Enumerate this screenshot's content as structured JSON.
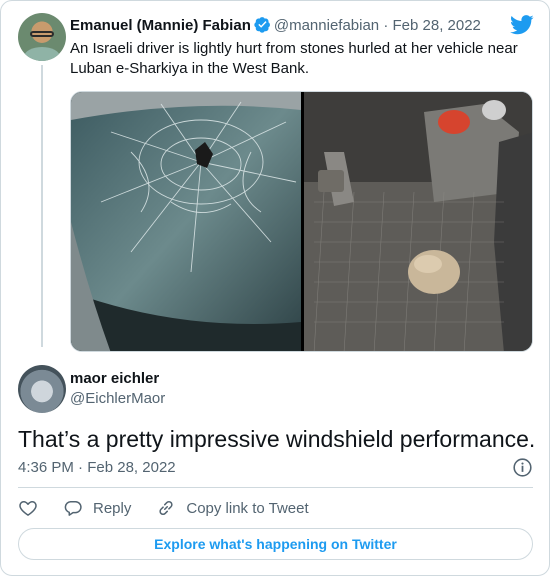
{
  "quoted_tweet": {
    "author_name": "Emanuel (Mannie) Fabian",
    "author_handle": "@manniefabian",
    "separator": "·",
    "date": "Feb 28, 2022",
    "text": "An Israeli driver is lightly hurt from stones hurled at her vehicle near Luban e-Sharkiya in the West Bank.",
    "verified": true,
    "media": [
      {
        "icon": "shattered-windshield-image"
      },
      {
        "icon": "car-floor-with-stone-image"
      }
    ]
  },
  "tweet": {
    "author_name": "maor eichler",
    "author_handle": "@EichlerMaor",
    "text": "That’s a pretty impressive windshield performance.",
    "time": "4:36 PM",
    "separator": "·",
    "date": "Feb 28, 2022"
  },
  "actions": {
    "like_icon": "heart-icon",
    "reply_label": "Reply",
    "copy_label": "Copy link to Tweet"
  },
  "explore_label": "Explore what's happening on Twitter",
  "colors": {
    "brand_blue": "#1d9bf0",
    "text_primary": "#0f1419",
    "text_secondary": "#536471",
    "border": "#cfd9de"
  }
}
